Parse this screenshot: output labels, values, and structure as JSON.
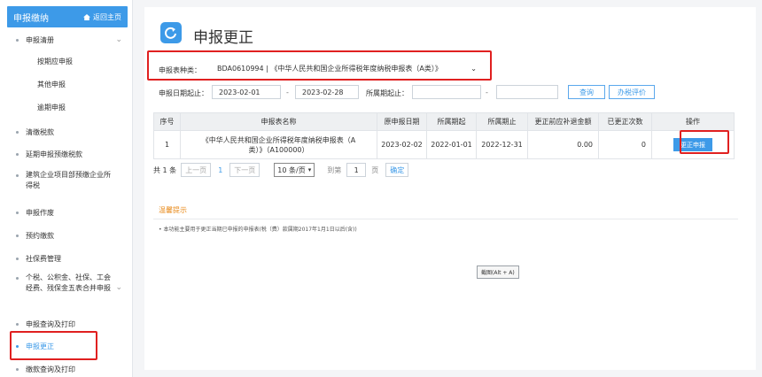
{
  "sidebar": {
    "header": "申报缴纳",
    "home_link": "返回主页",
    "groups": [
      {
        "label": "申报清册"
      },
      {
        "label": "清缴税款"
      },
      {
        "label": "延期申报预缴税款"
      },
      {
        "label": "建筑企业项目部预缴企业所得税"
      },
      {
        "label": "申报作废"
      },
      {
        "label": "预约缴款"
      },
      {
        "label": "社保费管理"
      },
      {
        "label": "个税、公积金、社保、工会经费、残保金五表合并申报"
      },
      {
        "label": "申报查询及打印"
      },
      {
        "label": "申报更正"
      },
      {
        "label": "缴款查询及打印"
      }
    ],
    "subitems": [
      {
        "label": "按期应申报"
      },
      {
        "label": "其他申报"
      },
      {
        "label": "逾期申报"
      }
    ]
  },
  "page": {
    "title": "申报更正"
  },
  "filters": {
    "type_label": "申报表种类：",
    "type_value": "BDA0610994 | 《中华人民共和国企业所得税年度纳税申报表（A类）》",
    "date_label": "申报日期起止：",
    "date_from": "2023-02-01",
    "date_to": "2023-02-28",
    "period_label": "所属期起止：",
    "period_from": "",
    "period_to": "",
    "dash": "-",
    "query_btn": "查询",
    "eval_btn": "办税评价"
  },
  "table": {
    "headers": [
      "序号",
      "申报表名称",
      "原申报日期",
      "所属期起",
      "所属期止",
      "更正前应补退金额",
      "已更正次数",
      "操作"
    ],
    "row": {
      "index": "1",
      "name_line1": "《中华人民共和国企业所得税年度纳税申报表（A",
      "name_line2": "类）》（A100000）",
      "orig_date": "2023-02-02",
      "period_start": "2022-01-01",
      "period_end": "2022-12-31",
      "amount": "0.00",
      "count": "0",
      "action": "更正申报"
    }
  },
  "pager": {
    "total": "共 1 条",
    "prev": "上一页",
    "current": "1",
    "next": "下一页",
    "page_size": "10 条/页",
    "goto_label": "到第",
    "goto_value": "1",
    "page_unit": "页",
    "confirm": "确定"
  },
  "tips": {
    "title": "温馨提示",
    "text": "• 本功能主要用于更正当期已申报的申报表(税（费）款属期2017年1月1日以后(含))"
  },
  "tooltip": "截图(Alt + A)",
  "colors": {
    "accent": "#3d9ae8",
    "highlight": "#e02020",
    "tips": "#e88a1a"
  }
}
